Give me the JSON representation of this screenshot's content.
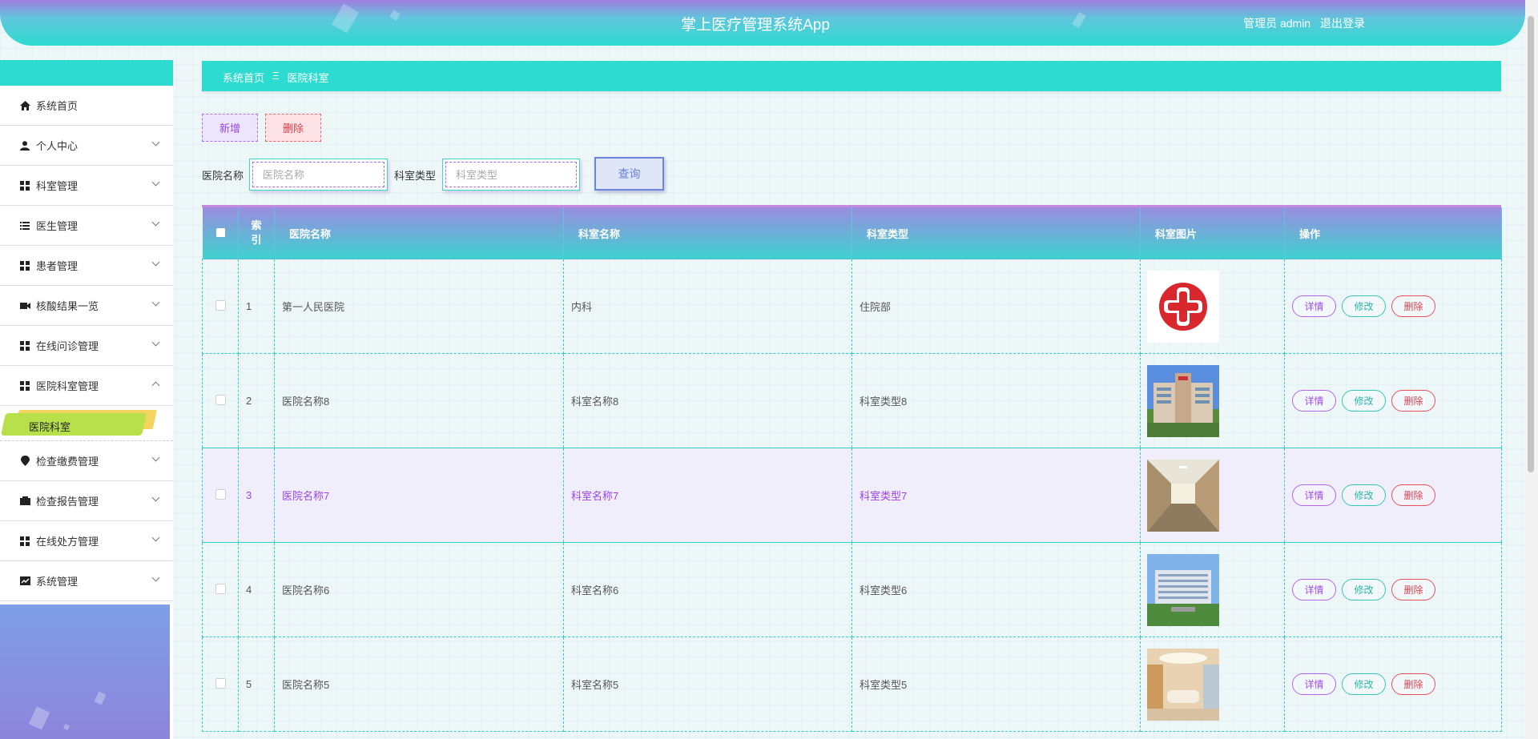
{
  "header": {
    "title": "掌上医疗管理系统App",
    "user_label": "管理员 admin",
    "logout_label": "退出登录"
  },
  "sidebar": {
    "items": [
      {
        "label": "系统首页",
        "icon": "home-icon"
      },
      {
        "label": "个人中心",
        "icon": "user-icon"
      },
      {
        "label": "科室管理",
        "icon": "grid-icon"
      },
      {
        "label": "医生管理",
        "icon": "list-icon"
      },
      {
        "label": "患者管理",
        "icon": "grid-icon"
      },
      {
        "label": "核酸结果一览",
        "icon": "camera-icon"
      },
      {
        "label": "在线问诊管理",
        "icon": "grid-icon"
      },
      {
        "label": "医院科室管理",
        "icon": "grid-icon"
      }
    ],
    "active_sub": "医院科室",
    "items_after": [
      {
        "label": "检查缴费管理",
        "icon": "pin-icon"
      },
      {
        "label": "检查报告管理",
        "icon": "wallet-icon"
      },
      {
        "label": "在线处方管理",
        "icon": "grid-icon"
      },
      {
        "label": "系统管理",
        "icon": "chart-icon"
      }
    ]
  },
  "breadcrumb": {
    "home": "系统首页",
    "separator": "Ξ",
    "current": "医院科室"
  },
  "toolbar": {
    "add_label": "新增",
    "delete_label": "删除"
  },
  "search": {
    "hospital_label": "医院名称",
    "hospital_placeholder": "医院名称",
    "type_label": "科室类型",
    "type_placeholder": "科室类型",
    "query_label": "查询"
  },
  "table": {
    "headers": [
      "索引",
      "医院名称",
      "科室名称",
      "科室类型",
      "科室图片",
      "操作"
    ],
    "index_header_line1": "索",
    "index_header_line2": "引",
    "rows": [
      {
        "index": "1",
        "hospital": "第一人民医院",
        "dept": "内科",
        "type": "住院部",
        "image": "red-cross"
      },
      {
        "index": "2",
        "hospital": "医院名称8",
        "dept": "科室名称8",
        "type": "科室类型8",
        "image": "hospital-building"
      },
      {
        "index": "3",
        "hospital": "医院名称7",
        "dept": "科室名称7",
        "type": "科室类型7",
        "image": "hospital-corridor"
      },
      {
        "index": "4",
        "hospital": "医院名称6",
        "dept": "科室名称6",
        "type": "科室类型6",
        "image": "hospital-tower"
      },
      {
        "index": "5",
        "hospital": "医院名称5",
        "dept": "科室名称5",
        "type": "科室类型5",
        "image": "reception-hall"
      }
    ],
    "actions": {
      "detail": "详情",
      "edit": "修改",
      "delete": "删除"
    }
  },
  "colors": {
    "accent_teal": "#2edbd0",
    "accent_purple": "#9a47e8",
    "danger": "#e0434f"
  }
}
